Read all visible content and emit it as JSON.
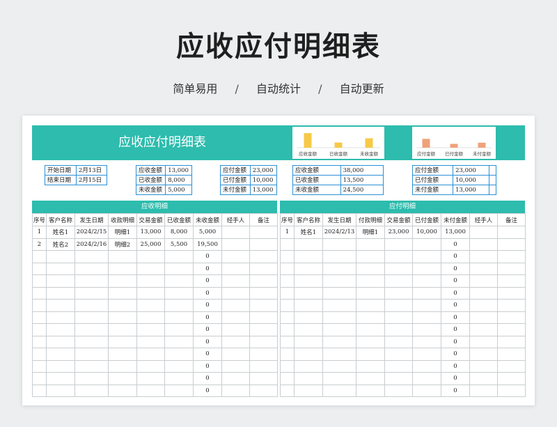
{
  "title": "应收应付明细表",
  "tags": [
    "简单易用",
    "自动统计",
    "自动更新"
  ],
  "tag_sep": "/",
  "sheet": {
    "banner_title": "应收应付明细表",
    "chart_left": {
      "type": "bar",
      "categories": [
        "应收金额",
        "已收金额",
        "未收金额"
      ],
      "values": [
        38000,
        13500,
        24500
      ],
      "color": "#f7c948",
      "ylim": [
        0,
        40000
      ]
    },
    "chart_right": {
      "type": "bar",
      "categories": [
        "应付金额",
        "已付金额",
        "未付金额"
      ],
      "values": [
        23000,
        10000,
        13000
      ],
      "color": "#f0a27a",
      "ylim": [
        0,
        40000
      ]
    },
    "date_table": [
      [
        "开始日期",
        "2月13日"
      ],
      [
        "结束日期",
        "2月15日"
      ]
    ],
    "recv_table": [
      [
        "应收金额",
        "13,000"
      ],
      [
        "已收金额",
        "8,000"
      ],
      [
        "未收金额",
        "5,000"
      ]
    ],
    "pay_table": [
      [
        "应付金额",
        "23,000"
      ],
      [
        "已付金额",
        "10,000"
      ],
      [
        "未付金额",
        "13,000"
      ]
    ],
    "recv_total_table": [
      [
        "应收金额",
        "38,000"
      ],
      [
        "已收金额",
        "13,500"
      ],
      [
        "未收金额",
        "24,500"
      ]
    ],
    "pay_total_table": [
      [
        "应付金额",
        "23,000",
        ""
      ],
      [
        "已付金额",
        "10,000",
        ""
      ],
      [
        "未付金额",
        "13,000",
        ""
      ]
    ],
    "receivable": {
      "header": "应收明细",
      "columns": [
        "序号",
        "客户名称",
        "发生日期",
        "收款明细",
        "交易金额",
        "已收金额",
        "未收金额",
        "经手人",
        "备注"
      ],
      "rows": [
        [
          "1",
          "姓名1",
          "2024/2/15",
          "明细1",
          "13,000",
          "8,000",
          "5,000",
          "",
          ""
        ],
        [
          "2",
          "姓名2",
          "2024/2/16",
          "明细2",
          "25,000",
          "5,500",
          "19,500",
          "",
          ""
        ],
        [
          "",
          "",
          "",
          "",
          "",
          "",
          "0",
          "",
          ""
        ],
        [
          "",
          "",
          "",
          "",
          "",
          "",
          "0",
          "",
          ""
        ],
        [
          "",
          "",
          "",
          "",
          "",
          "",
          "0",
          "",
          ""
        ],
        [
          "",
          "",
          "",
          "",
          "",
          "",
          "0",
          "",
          ""
        ],
        [
          "",
          "",
          "",
          "",
          "",
          "",
          "0",
          "",
          ""
        ],
        [
          "",
          "",
          "",
          "",
          "",
          "",
          "0",
          "",
          ""
        ],
        [
          "",
          "",
          "",
          "",
          "",
          "",
          "0",
          "",
          ""
        ],
        [
          "",
          "",
          "",
          "",
          "",
          "",
          "0",
          "",
          ""
        ],
        [
          "",
          "",
          "",
          "",
          "",
          "",
          "0",
          "",
          ""
        ],
        [
          "",
          "",
          "",
          "",
          "",
          "",
          "0",
          "",
          ""
        ],
        [
          "",
          "",
          "",
          "",
          "",
          "",
          "0",
          "",
          ""
        ],
        [
          "",
          "",
          "",
          "",
          "",
          "",
          "0",
          "",
          ""
        ]
      ]
    },
    "payable": {
      "header": "应付明细",
      "columns": [
        "序号",
        "客户名称",
        "发生日期",
        "付款明细",
        "交易金额",
        "已付金额",
        "未付金额",
        "经手人",
        "备注"
      ],
      "rows": [
        [
          "1",
          "姓名1",
          "2024/2/13",
          "明细1",
          "23,000",
          "10,000",
          "13,000",
          "",
          ""
        ],
        [
          "",
          "",
          "",
          "",
          "",
          "",
          "0",
          "",
          ""
        ],
        [
          "",
          "",
          "",
          "",
          "",
          "",
          "0",
          "",
          ""
        ],
        [
          "",
          "",
          "",
          "",
          "",
          "",
          "0",
          "",
          ""
        ],
        [
          "",
          "",
          "",
          "",
          "",
          "",
          "0",
          "",
          ""
        ],
        [
          "",
          "",
          "",
          "",
          "",
          "",
          "0",
          "",
          ""
        ],
        [
          "",
          "",
          "",
          "",
          "",
          "",
          "0",
          "",
          ""
        ],
        [
          "",
          "",
          "",
          "",
          "",
          "",
          "0",
          "",
          ""
        ],
        [
          "",
          "",
          "",
          "",
          "",
          "",
          "0",
          "",
          ""
        ],
        [
          "",
          "",
          "",
          "",
          "",
          "",
          "0",
          "",
          ""
        ],
        [
          "",
          "",
          "",
          "",
          "",
          "",
          "0",
          "",
          ""
        ],
        [
          "",
          "",
          "",
          "",
          "",
          "",
          "0",
          "",
          ""
        ],
        [
          "",
          "",
          "",
          "",
          "",
          "",
          "0",
          "",
          ""
        ],
        [
          "",
          "",
          "",
          "",
          "",
          "",
          "0",
          "",
          ""
        ]
      ]
    }
  }
}
